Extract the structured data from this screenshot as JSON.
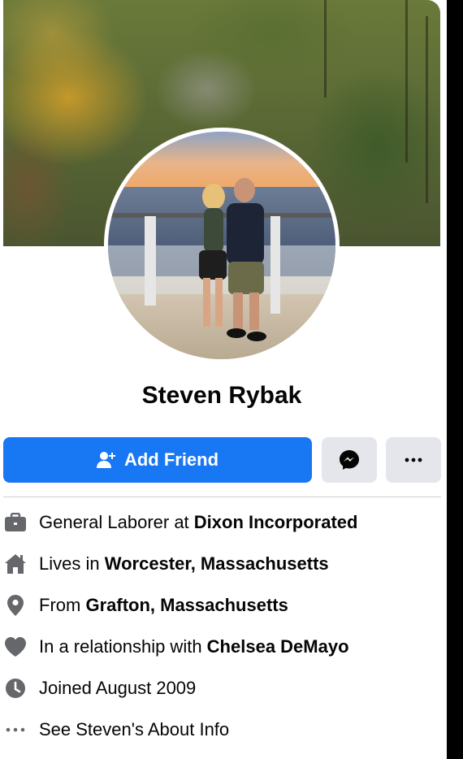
{
  "profile": {
    "name": "Steven Rybak"
  },
  "actions": {
    "add_friend_label": "Add Friend",
    "messenger_icon": "messenger-icon",
    "more_icon": "more-icon"
  },
  "info": [
    {
      "icon": "briefcase-icon",
      "prefix": "General Laborer at ",
      "bold": "Dixon Incorporated"
    },
    {
      "icon": "home-icon",
      "prefix": "Lives in ",
      "bold": "Worcester, Massachusetts"
    },
    {
      "icon": "location-pin-icon",
      "prefix": "From ",
      "bold": "Grafton, Massachusetts"
    },
    {
      "icon": "heart-icon",
      "prefix": "In a relationship with ",
      "bold": "Chelsea DeMayo"
    },
    {
      "icon": "clock-icon",
      "prefix": "Joined August 2009",
      "bold": ""
    },
    {
      "icon": "more-dots-icon",
      "prefix": "See Steven's About Info",
      "bold": ""
    }
  ],
  "colors": {
    "primary_button": "#1877f2",
    "secondary_button": "#e4e6eb",
    "icon_gray": "#65676b"
  }
}
